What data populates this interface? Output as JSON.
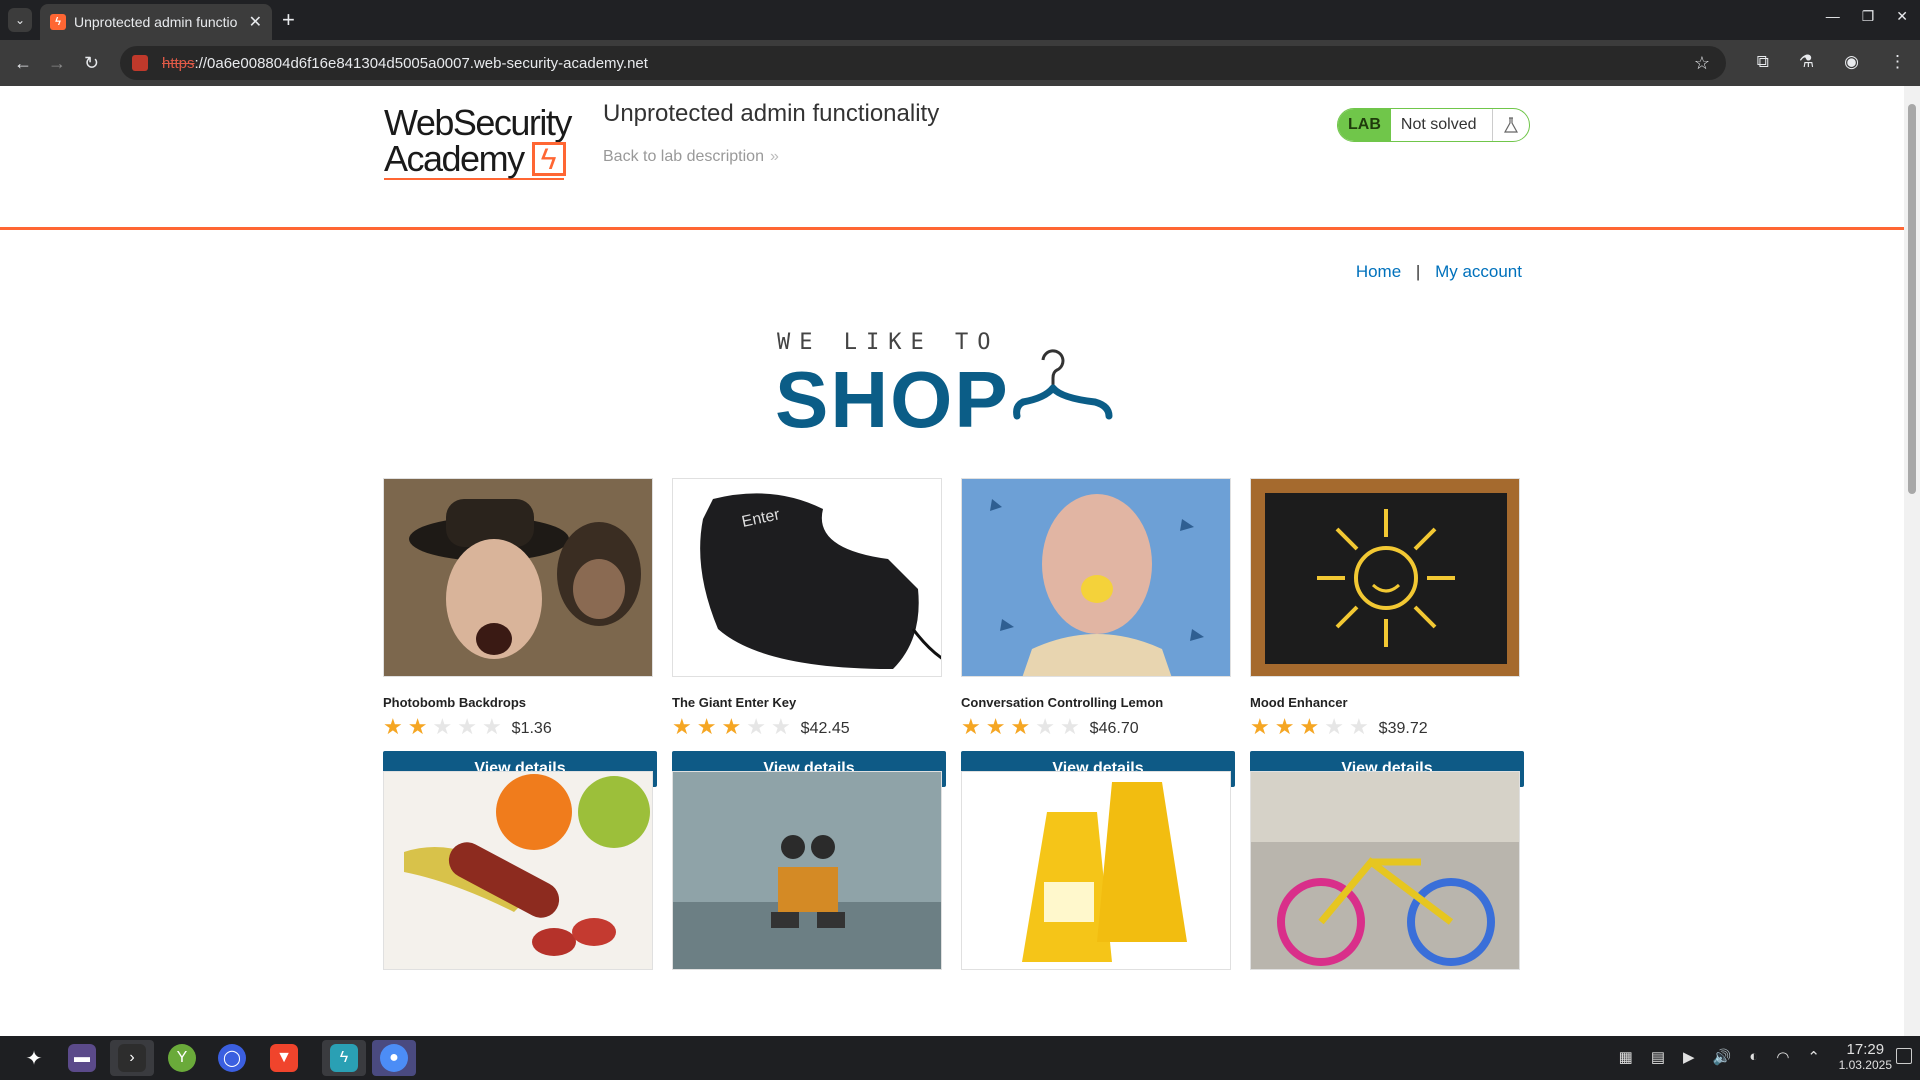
{
  "browser": {
    "tab_title": "Unprotected admin functio",
    "url_scheme": "https",
    "url_rest": "://0a6e008804d6f16e841304d5005a0007.web-security-academy.net"
  },
  "header": {
    "logo_line1": "WebSecurity",
    "logo_line2": "Academy",
    "lab_title": "Unprotected admin functionality",
    "back_link": "Back to lab description",
    "lab_badge": "LAB",
    "lab_status": "Not solved"
  },
  "nav": {
    "home": "Home",
    "separator": "|",
    "my_account": "My account"
  },
  "hero": {
    "small": "WE LIKE TO",
    "big": "SHOP"
  },
  "products": [
    {
      "name": "Photobomb Backdrops",
      "rating": 2,
      "price": "$1.36",
      "button": "View details"
    },
    {
      "name": "The Giant Enter Key",
      "rating": 3,
      "price": "$42.45",
      "button": "View details"
    },
    {
      "name": "Conversation Controlling Lemon",
      "rating": 3,
      "price": "$46.70",
      "button": "View details"
    },
    {
      "name": "Mood Enhancer",
      "rating": 3,
      "price": "$39.72",
      "button": "View details"
    }
  ],
  "taskbar": {
    "time": "17:29",
    "date": "1.03.2025"
  },
  "colors": {
    "accent": "#ff6633",
    "button": "#0e5a86",
    "link": "#0071bc",
    "lab_green": "#70c64a",
    "star": "#f5a623"
  }
}
